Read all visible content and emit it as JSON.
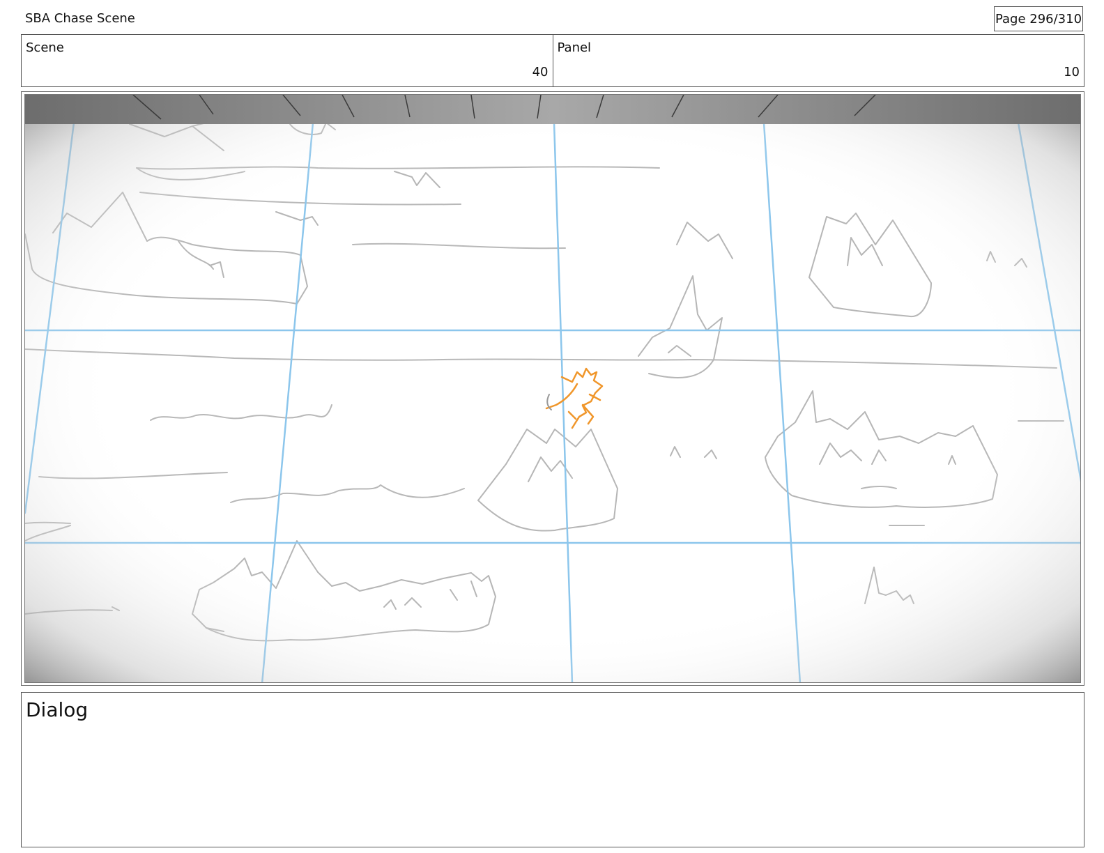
{
  "header": {
    "title": "SBA Chase Scene",
    "page": "Page 296/310"
  },
  "info": {
    "scene_label": "Scene",
    "scene_value": "40",
    "panel_label": "Panel",
    "panel_value": "10"
  },
  "dialog": {
    "label": "Dialog"
  },
  "colors": {
    "guide_line": "#8cc6ec",
    "sketch_line": "#b5b5b5",
    "character": "#f0962a"
  }
}
